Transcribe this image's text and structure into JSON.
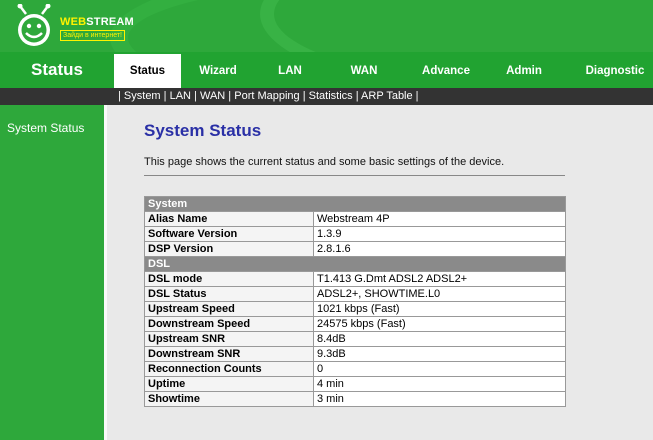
{
  "brand": {
    "name_part1": "WEB",
    "name_part2": "STREAM",
    "tagline": "Зайди в интернет!"
  },
  "nav": {
    "title": "Status",
    "tabs": [
      "Status",
      "Wizard",
      "LAN",
      "WAN",
      "Advance",
      "Admin",
      "Diagnostic"
    ],
    "active_tab": "Status"
  },
  "subnav": {
    "items": [
      "System",
      "LAN",
      "WAN",
      "Port Mapping",
      "Statistics",
      "ARP Table"
    ]
  },
  "sidebar": {
    "items": [
      {
        "label": "System Status"
      }
    ]
  },
  "main": {
    "title": "System Status",
    "description": "This page shows the current status and some basic settings of the device."
  },
  "sections": [
    {
      "title": "System",
      "rows": [
        {
          "label": "Alias Name",
          "value": "Webstream 4P"
        },
        {
          "label": "Software Version",
          "value": "1.3.9"
        },
        {
          "label": "DSP Version",
          "value": "2.8.1.6"
        }
      ]
    },
    {
      "title": "DSL",
      "rows": [
        {
          "label": "DSL mode",
          "value": "T1.413 G.Dmt ADSL2 ADSL2+"
        },
        {
          "label": "DSL Status",
          "value": "ADSL2+, SHOWTIME.L0"
        },
        {
          "label": "Upstream Speed",
          "value": "1021 kbps  (Fast)"
        },
        {
          "label": "Downstream Speed",
          "value": "24575 kbps  (Fast)"
        },
        {
          "label": "Upstream SNR",
          "value": "8.4dB"
        },
        {
          "label": "Downstream SNR",
          "value": "9.3dB"
        },
        {
          "label": "Reconnection Counts",
          "value": "0"
        },
        {
          "label": "Uptime",
          "value": "4 min"
        },
        {
          "label": "Showtime",
          "value": "3 min"
        }
      ]
    }
  ],
  "colors": {
    "header_green": "#2ea83b",
    "nav_green": "#21a331",
    "subnav_dark": "#333333",
    "title_blue": "#2a30a6",
    "section_gray": "#8a8a8a"
  }
}
